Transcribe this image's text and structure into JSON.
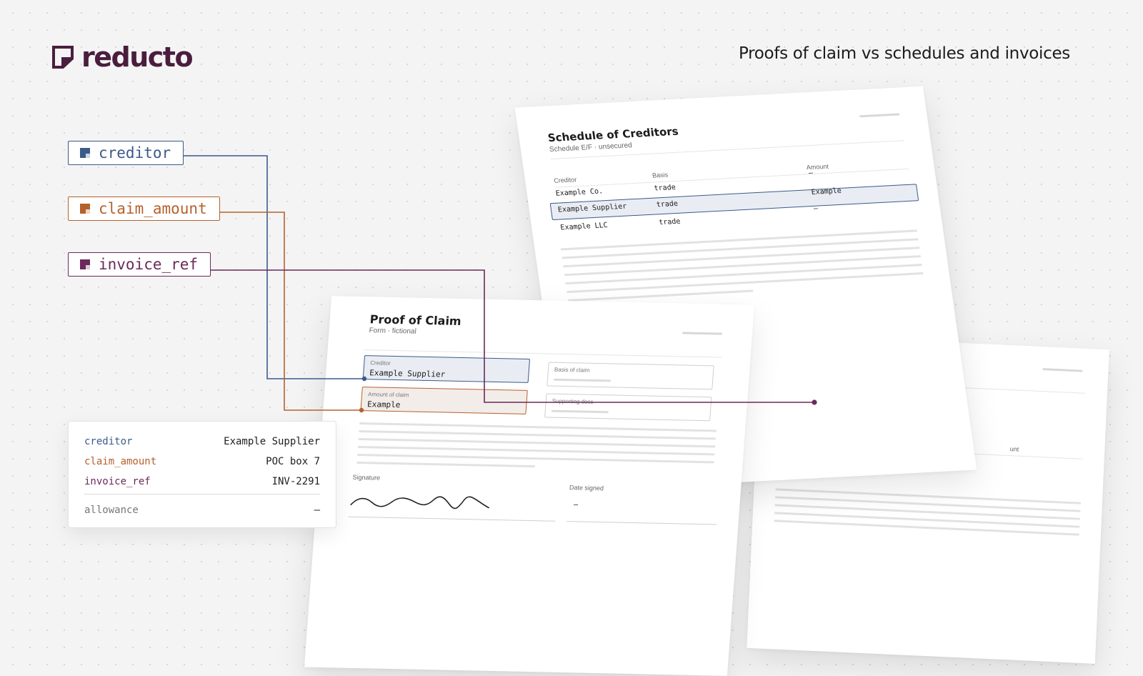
{
  "header": {
    "brand": "reducto",
    "title": "Proofs of claim vs schedules and invoices"
  },
  "fields": [
    {
      "key": "creditor",
      "color": "#3b5a8a"
    },
    {
      "key": "claim_amount",
      "color": "#b5612e"
    },
    {
      "key": "invoice_ref",
      "color": "#6b2a5a"
    }
  ],
  "schedule": {
    "title": "Schedule of Creditors",
    "subtitle": "Schedule E/F · unsecured",
    "columns": [
      "Creditor",
      "Basis",
      "Amount"
    ],
    "rows": [
      {
        "creditor": "Example Co.",
        "basis": "trade",
        "amount": "—"
      },
      {
        "creditor": "Example Supplier",
        "basis": "trade",
        "amount": "Example"
      },
      {
        "creditor": "Example LLC",
        "basis": "trade",
        "amount": "—"
      }
    ]
  },
  "proof": {
    "title": "Proof of Claim",
    "subtitle": "Form · fictional",
    "creditor_label": "Creditor",
    "creditor_value": "Example Supplier",
    "basis_label": "Basis of claim",
    "amount_label": "Amount of claim",
    "amount_value": "Example",
    "docs_label": "Supporting docs",
    "signature_label": "Signature",
    "date_label": "Date signed",
    "date_value": "—"
  },
  "back_page": {
    "partial_column": "unt"
  },
  "result": {
    "rows": [
      {
        "key": "creditor",
        "value": "Example Supplier"
      },
      {
        "key": "claim_amount",
        "value": "POC box 7"
      },
      {
        "key": "invoice_ref",
        "value": "INV-2291"
      }
    ],
    "footer": {
      "key": "allowance",
      "value": "—"
    }
  }
}
